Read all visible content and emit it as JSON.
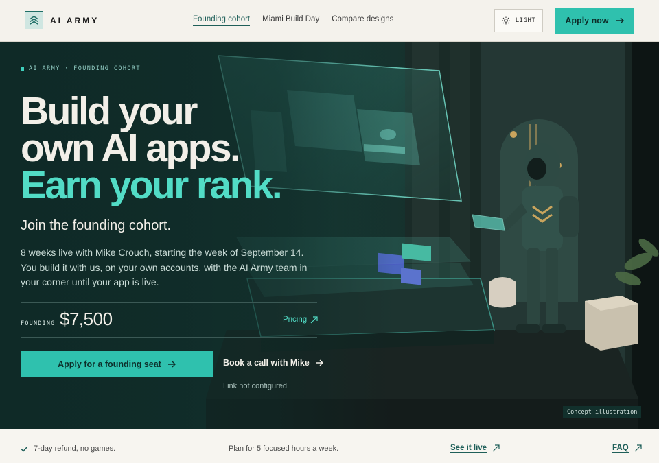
{
  "brand": {
    "name": "AI ARMY",
    "logo_icon": "chevrons-stack-icon"
  },
  "nav": {
    "items": [
      {
        "label": "Founding cohort",
        "active": true
      },
      {
        "label": "Miami Build Day",
        "active": false
      },
      {
        "label": "Compare designs",
        "active": false
      }
    ]
  },
  "theme_toggle": {
    "label": "LIGHT",
    "icon": "sun-icon"
  },
  "header_cta": {
    "label": "Apply now",
    "icon": "arrow-right-icon"
  },
  "hero": {
    "eyebrow": "AI ARMY · FOUNDING COHORT",
    "headline": {
      "line1": "Build your",
      "line2": "own AI apps.",
      "line3": "Earn your rank."
    },
    "subheadline": "Join the founding cohort.",
    "description": "8 weeks live with Mike Crouch, starting the week of September 14. You build it with us, on your own accounts, with the AI Army team in your corner until your app is live.",
    "price_label": "FOUNDING",
    "price": "$7,500",
    "pricing_link": "Pricing",
    "primary_cta": "Apply for a founding seat",
    "secondary_cta": "Book a call with Mike",
    "note": "Link not configured.",
    "image_caption": "Concept illustration"
  },
  "footer": {
    "guarantee": "7-day refund, no games.",
    "commitment": "Plan for 5 focused hours a week.",
    "live_link": "See it live",
    "faq_link": "FAQ"
  },
  "colors": {
    "accent": "#2fc1ae",
    "accent_light": "#52dcc6",
    "hero_bg": "#0f2a27",
    "page_bg": "#f4f2ec"
  }
}
